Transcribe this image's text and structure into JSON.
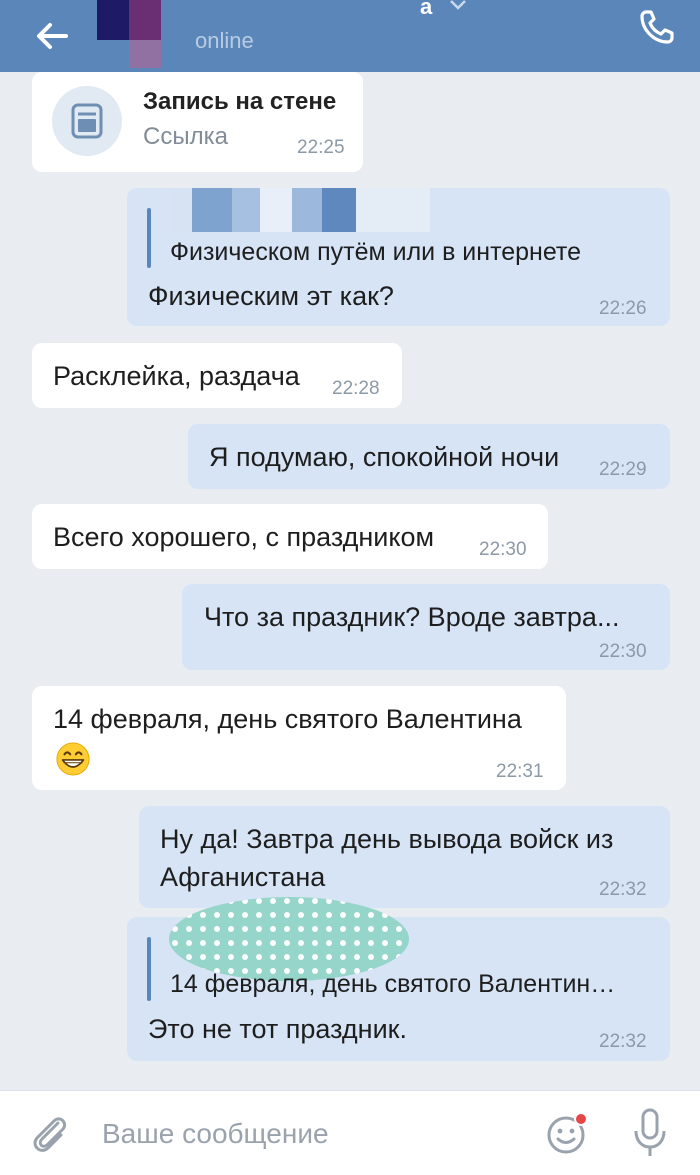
{
  "header": {
    "status_text": "online",
    "name_fragment": "a",
    "back_icon": "arrow-left-icon",
    "call_icon": "phone-icon",
    "colors": {
      "header_bg": "#5b86b9",
      "outgoing_bg": "#d6e4f6",
      "incoming_bg": "#ffffff"
    }
  },
  "messages": [
    {
      "dir": "in",
      "type": "wall_post",
      "title": "Запись на стене",
      "subtitle": "Ссылка",
      "time": "22:25"
    },
    {
      "dir": "out",
      "quote": "Физическом путём или в интернете",
      "text": "Физическим эт как?",
      "time": "22:26"
    },
    {
      "dir": "in",
      "text": "Расклейка, раздача",
      "time": "22:28"
    },
    {
      "dir": "out",
      "text": "Я подумаю, спокойной ночи",
      "time": "22:29"
    },
    {
      "dir": "in",
      "text": "Всего хорошего, с праздником",
      "time": "22:30"
    },
    {
      "dir": "out",
      "text": "Что за праздник? Вроде завтра...",
      "time": "22:30"
    },
    {
      "dir": "in",
      "text": "14 февраля, день святого Валентина",
      "emoji": "grinning-face",
      "time": "22:31"
    },
    {
      "dir": "out",
      "text_line1": "Ну да! Завтра день вывода войск из",
      "text_line2": "Афганистана",
      "time": "22:32"
    },
    {
      "dir": "out",
      "quote": "14 февраля, день святого Валентин…",
      "text": "Это не тот праздник.",
      "time": "22:32"
    }
  ],
  "input": {
    "placeholder": "Ваше сообщение",
    "value": "",
    "attach_icon": "paperclip-icon",
    "sticker_icon": "smiley-sticker-icon",
    "mic_icon": "microphone-icon"
  }
}
